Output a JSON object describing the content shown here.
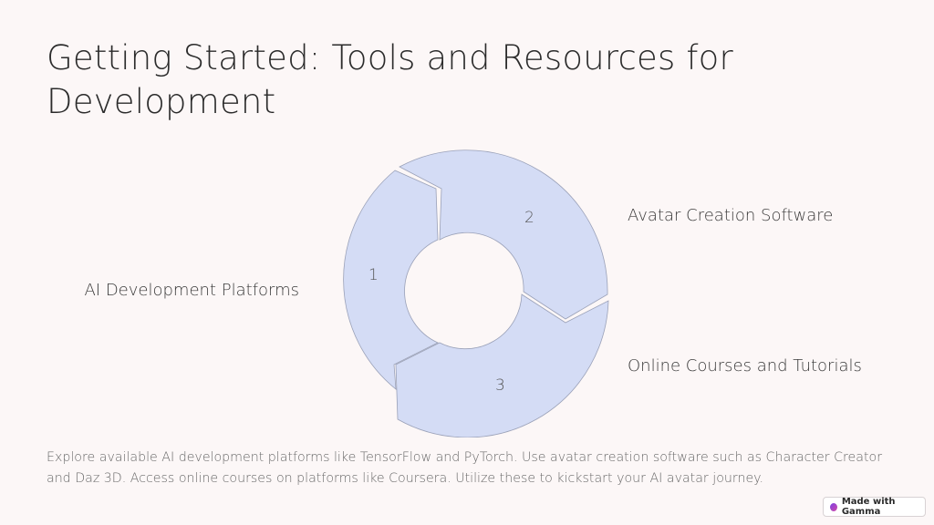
{
  "slide": {
    "title": "Getting Started: Tools and Resources for Development",
    "description": "Explore available AI development platforms like TensorFlow and PyTorch. Use avatar creation software such as Character Creator and Daz 3D. Access online courses on platforms like Coursera. Utilize these to kickstart your AI avatar journey."
  },
  "cycle": {
    "fill_color": "#d4dcf5",
    "steps": [
      {
        "number": "1",
        "label": "AI Development Platforms"
      },
      {
        "number": "2",
        "label": "Avatar Creation Software"
      },
      {
        "number": "3",
        "label": "Online Courses and Tutorials"
      }
    ]
  },
  "badge": {
    "label": "Made with Gamma",
    "icon": "gamma-logo-icon"
  }
}
